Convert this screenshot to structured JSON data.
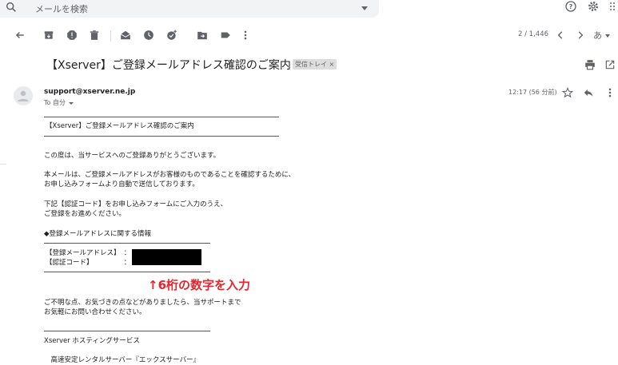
{
  "search": {
    "placeholder": "メールを検索"
  },
  "toolbar": {
    "pager": "2 / 1,446",
    "lang": "あ"
  },
  "email": {
    "subject": "【Xserver】ご登録メールアドレス確認のご案内",
    "label_chip": "受信トレイ ×",
    "sender": "support@xserver.ne.jp",
    "to": "To 自分",
    "time": "12:17 (56 分前)",
    "body": {
      "heading": "【Xserver】ご登録メールアドレス確認のご案内",
      "p1": "この度は、当サービスへのご登録ありがとうございます。",
      "p2a": "本メールは、ご登録メールアドレスがお客様のものであることを確認するために、",
      "p2b": "お申し込みフォームより自動で送信しております。",
      "p3a": "下記【認証コード】をお申し込みフォームにご入力のうえ、",
      "p3b": "ご登録をお進めください。",
      "info_heading": "◆登録メールアドレスに関する情報",
      "row1_label": "【登録メールアドレス】　：",
      "row2_label": "【認証コード】　　　　　：",
      "p4a": "ご不明な点、お気づきの点などがありましたら、当サポートまで",
      "p4b": "お気軽にお問い合わせください。",
      "footer1": "Xserver ホスティングサービス",
      "footer2": "　高速安定レンタルサーバー『エックスサーバー』"
    }
  },
  "annotation": {
    "text": "↑6桁の数字を入力",
    "color": "#e8242c"
  }
}
